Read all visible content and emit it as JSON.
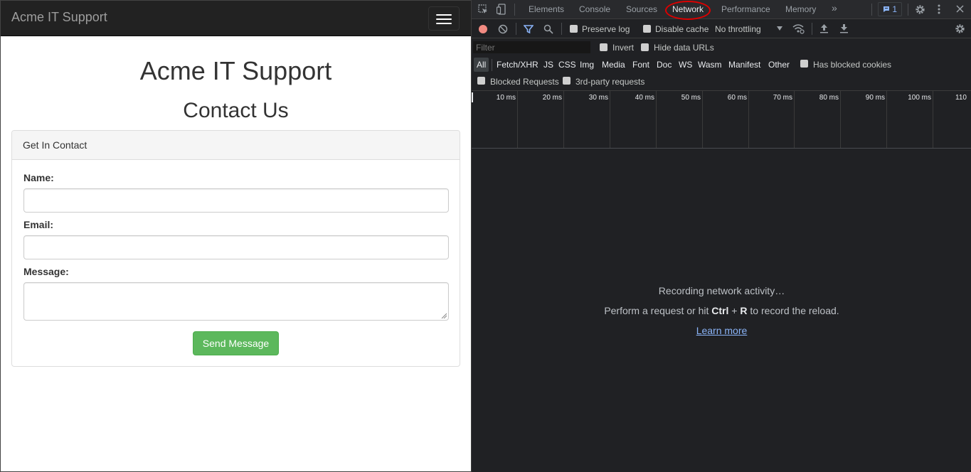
{
  "page": {
    "brand": "Acme IT Support",
    "site_title": "Acme IT Support",
    "section_title": "Contact Us",
    "panel_heading": "Get In Contact",
    "form": {
      "name_label": "Name:",
      "email_label": "Email:",
      "message_label": "Message:",
      "name_value": "",
      "email_value": "",
      "message_value": "",
      "submit_label": "Send Message"
    },
    "colors": {
      "navbar": "#222222",
      "button": "#5cb85c"
    }
  },
  "devtools": {
    "tabs": [
      "Elements",
      "Console",
      "Sources",
      "Network",
      "Performance",
      "Memory"
    ],
    "active_tab": "Network",
    "more_tabs": "»",
    "issues_count": "1",
    "toolbar": {
      "preserve_log": "Preserve log",
      "disable_cache": "Disable cache",
      "throttling": "No throttling"
    },
    "filter": {
      "placeholder": "Filter",
      "invert": "Invert",
      "hide_data_urls": "Hide data URLs",
      "types": [
        "All",
        "Fetch/XHR",
        "JS",
        "CSS",
        "Img",
        "Media",
        "Font",
        "Doc",
        "WS",
        "Wasm",
        "Manifest",
        "Other"
      ],
      "has_blocked_cookies": "Has blocked cookies",
      "blocked_requests": "Blocked Requests",
      "third_party": "3rd-party requests"
    },
    "timeline_ticks": [
      "10 ms",
      "20 ms",
      "30 ms",
      "40 ms",
      "50 ms",
      "60 ms",
      "70 ms",
      "80 ms",
      "90 ms",
      "100 ms",
      "110"
    ],
    "empty": {
      "recording": "Recording network activity…",
      "hint_before": "Perform a request or hit ",
      "hint_key1": "Ctrl",
      "hint_plus": " + ",
      "hint_key2": "R",
      "hint_after": " to record the reload.",
      "learn_more": "Learn more"
    },
    "colors": {
      "background": "#202124",
      "link": "#8ab4f8",
      "record": "#f28b82"
    }
  }
}
